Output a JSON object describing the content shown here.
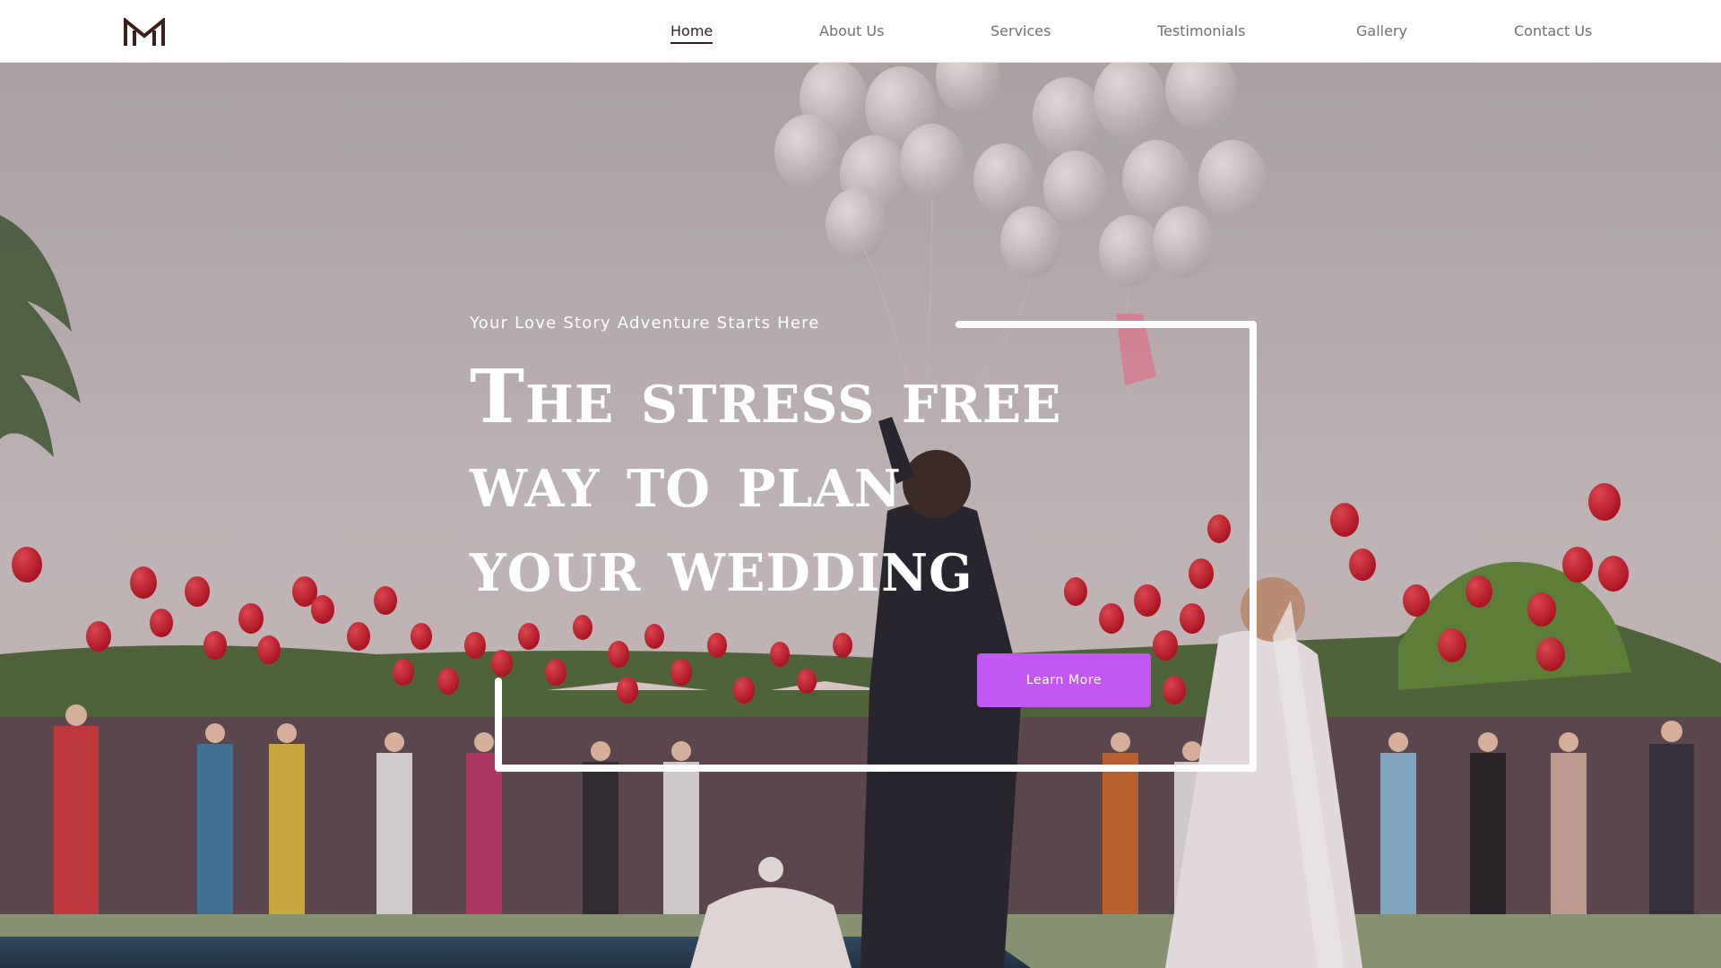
{
  "brand": {
    "logo_icon": "m-monogram-icon"
  },
  "nav": {
    "items": [
      {
        "label": "Home",
        "active": true
      },
      {
        "label": "About Us",
        "active": false
      },
      {
        "label": "Services",
        "active": false
      },
      {
        "label": "Testimonials",
        "active": false
      },
      {
        "label": "Gallery",
        "active": false
      },
      {
        "label": "Contact Us",
        "active": false
      }
    ]
  },
  "hero": {
    "tagline": "Your Love Story Adventure Starts Here",
    "headline": {
      "line1": "The stress free",
      "line2": "way to plan",
      "line3": "your wedding"
    },
    "cta_label": "Learn More",
    "background_image": "wedding-couple-releasing-balloons-photo"
  },
  "colors": {
    "accent": "#c257f5",
    "brand_dark": "#3a1f1c",
    "nav_text": "#707070",
    "balloon_red": "#d81f2e",
    "balloon_white": "#ece6e5"
  }
}
